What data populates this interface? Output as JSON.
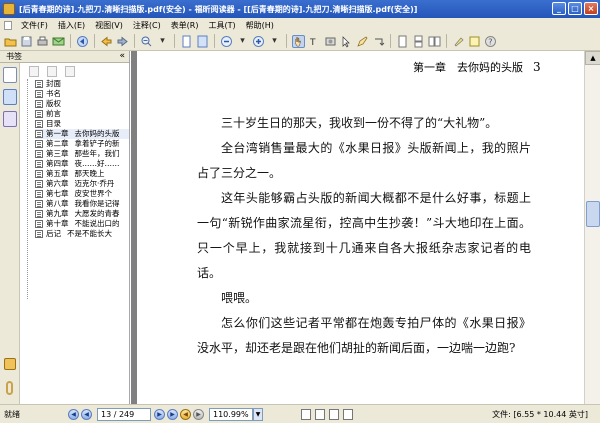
{
  "window": {
    "title": "[后青春期的诗].九把刀.清晰扫描版.pdf(安全) - 福昕阅读器 - [[后青春期的诗].九把刀.清晰扫描版.pdf(安全)]",
    "minimize": "_",
    "restore": "□",
    "close": "×"
  },
  "menu": [
    "文件(F)",
    "插入(E)",
    "视图(V)",
    "注释(C)",
    "表单(R)",
    "工具(T)",
    "帮助(H)"
  ],
  "sidebar": {
    "title": "书签",
    "collapse": "«",
    "bookmarks": [
      {
        "label": "封面",
        "sub": ""
      },
      {
        "label": "书名",
        "sub": ""
      },
      {
        "label": "版权",
        "sub": ""
      },
      {
        "label": "前言",
        "sub": ""
      },
      {
        "label": "目录",
        "sub": ""
      },
      {
        "label": "第一章",
        "sub": "去你妈的头版",
        "selected": true
      },
      {
        "label": "第二章",
        "sub": "拿着铲子的新"
      },
      {
        "label": "第三章",
        "sub": "那些年，我们"
      },
      {
        "label": "第四章",
        "sub": "夜……好……"
      },
      {
        "label": "第五章",
        "sub": "那天晚上"
      },
      {
        "label": "第六章",
        "sub": "迈克尔·乔丹"
      },
      {
        "label": "第七章",
        "sub": "皮安世界个"
      },
      {
        "label": "第八章",
        "sub": "我看你是记得"
      },
      {
        "label": "第九章",
        "sub": "大愿发的青春"
      },
      {
        "label": "第十章",
        "sub": "不能说出口的"
      },
      {
        "label": "后记",
        "sub": "不是不能长大"
      }
    ]
  },
  "document": {
    "header_chapter": "第一章　去你妈的头版",
    "header_page": "3",
    "paragraphs": [
      "三十岁生日的那天，我收到一份不得了的“大礼物”。",
      "全台湾销售量最大的《水果日报》头版新闻上，我的照片占了三分之一。",
      "这年头能够霸占头版的新闻大概都不是什么好事，标题上一句“新锐作曲家流星衔，控高中生抄袭！”斗大地印在上面。只一个早上，我就接到十几通来自各大报纸杂志家记者的电话。",
      "喂喂。",
      "怎么你们这些记者平常都在炮轰专拍尸体的《水果日报》没水平，却还老是跟在他们胡扯的新闻后面，一边喘一边跑?"
    ]
  },
  "status": {
    "left": "就绪",
    "page_input": "13 / 249",
    "zoom": "110.99%",
    "file_info": "文件: [6.55 * 10.44 英寸]"
  }
}
